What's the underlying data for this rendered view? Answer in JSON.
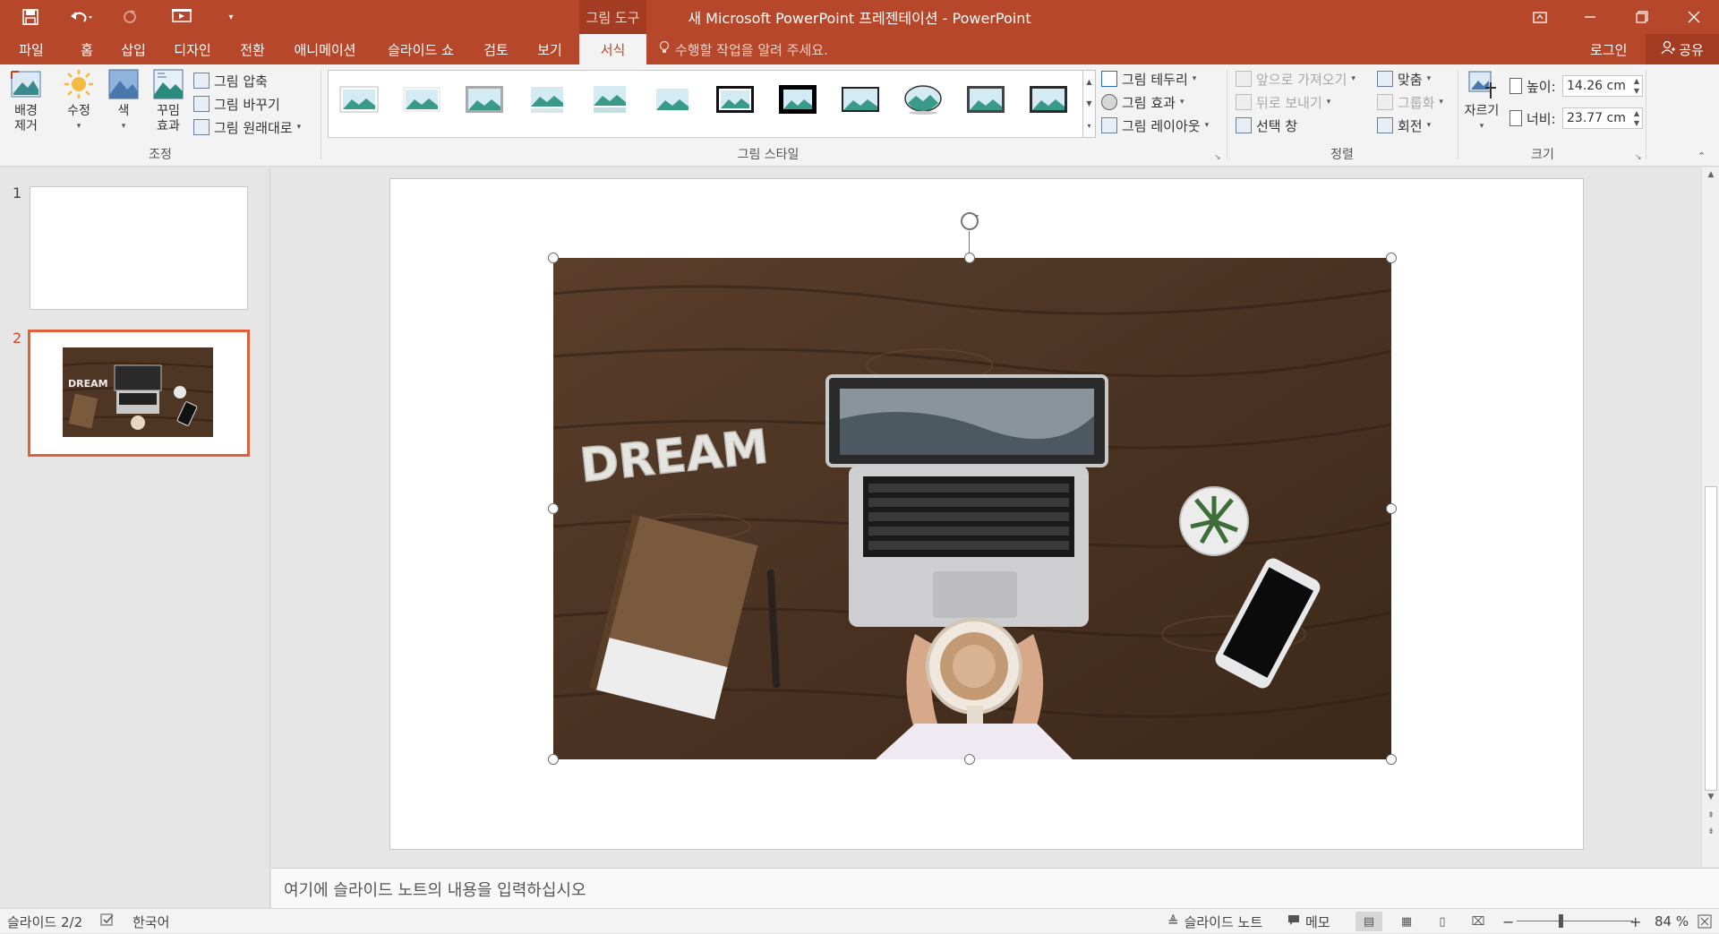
{
  "title_bar": {
    "context_tab": "그림 도구",
    "window_title": "새 Microsoft PowerPoint 프레젠테이션 - PowerPoint",
    "icons": [
      "save-icon",
      "undo-icon",
      "redo-icon",
      "start-from-beginning-icon",
      "customize-quick-access-icon"
    ]
  },
  "tabs": [
    {
      "label": "파일"
    },
    {
      "label": "홈"
    },
    {
      "label": "삽입"
    },
    {
      "label": "디자인"
    },
    {
      "label": "전환"
    },
    {
      "label": "애니메이션"
    },
    {
      "label": "슬라이드 쇼"
    },
    {
      "label": "검토"
    },
    {
      "label": "보기"
    },
    {
      "label": "서식"
    }
  ],
  "active_tab": "서식",
  "tell_me": "수행할 작업을 알려 주세요.",
  "account": {
    "login": "로그인",
    "share": "공유"
  },
  "ribbon": {
    "adjust": {
      "label": "조정",
      "remove_bg": "배경\n제거",
      "corrections": "수정",
      "color": "색",
      "artistic": "꾸밈\n효과",
      "compress": "그림 압축",
      "change": "그림 바꾸기",
      "reset": "그림 원래대로"
    },
    "styles": {
      "label": "그림 스타일",
      "border": "그림 테두리",
      "effects": "그림 효과",
      "layout": "그림 레이아웃"
    },
    "arrange": {
      "label": "정렬",
      "bring_forward": "앞으로 가져오기",
      "send_backward": "뒤로 보내기",
      "selection_pane": "선택 창",
      "align": "맞춤",
      "group": "그룹화",
      "rotate": "회전"
    },
    "size": {
      "label": "크기",
      "crop": "자르기",
      "height_label": "높이:",
      "height_value": "14.26 cm",
      "width_label": "너비:",
      "width_value": "23.77 cm"
    }
  },
  "slides": {
    "items": [
      {
        "number": "1"
      },
      {
        "number": "2"
      }
    ],
    "selected": "2"
  },
  "slide_image_text": "DREAM",
  "notes_placeholder": "여기에 슬라이드 노트의 내용을 입력하십시오",
  "status": {
    "slide_info": "슬라이드 2/2",
    "language": "한국어",
    "notes_btn": "슬라이드 노트",
    "comments_btn": "메모",
    "zoom": "84 %"
  },
  "colors": {
    "accent": "#b7472a",
    "selection": "#e0603c"
  }
}
